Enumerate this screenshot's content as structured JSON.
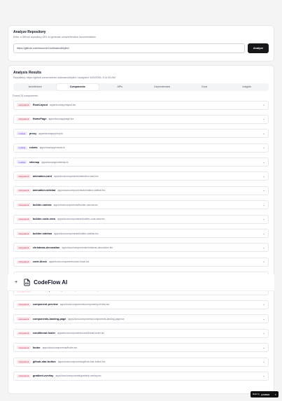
{
  "analyze": {
    "title": "Analyze Repository",
    "subtitle": "Enter a GitHub repository URL to generate comprehensive documentation",
    "repo_value": "https://github.com/moumen-soliman/uitripled",
    "button_label": "Analyze"
  },
  "results": {
    "title": "Analysis Results",
    "meta": "Repository: https://github.com/moumen-soliman/uitripled • Analyzed: 5/20/2026, 9:14:45 AM",
    "tabs": [
      "Architecture",
      "Components",
      "APIs",
      "Dependencies",
      "Docs",
      "Insights"
    ],
    "active_tab": "Components",
    "found_text": "Found 25 components"
  },
  "items": [
    {
      "type": "component",
      "name": "RootLayout",
      "path": "apps/docs/app/layout.tsx"
    },
    {
      "type": "component",
      "name": "HomePage",
      "path": "apps/docs/app/page.tsx"
    },
    {
      "type": "module",
      "name": "proxy",
      "path": "apps/docs/app/proxy.ts"
    },
    {
      "type": "module",
      "name": "robots",
      "path": "apps/docs/app/robots.ts"
    },
    {
      "type": "module",
      "name": "sitemap",
      "path": "apps/docs/app/sitemap.ts"
    },
    {
      "type": "component",
      "name": "animation-card",
      "path": "apps/docs/components/animation-card.tsx"
    },
    {
      "type": "component",
      "name": "animation-sidebar",
      "path": "apps/docs/components/animation-sidebar.tsx"
    },
    {
      "type": "component",
      "name": "builder-canvas",
      "path": "apps/docs/components/builder-canvas.tsx"
    },
    {
      "type": "component",
      "name": "builder-code-view",
      "path": "apps/docs/components/builder-code-view.tsx"
    },
    {
      "type": "component",
      "name": "builder-sidebar",
      "path": "apps/docs/components/builder-sidebar.tsx"
    },
    {
      "type": "component",
      "name": "christmas-decoration",
      "path": "apps/docs/components/christmas-decoration.tsx"
    },
    {
      "type": "component",
      "name": "code-block",
      "path": "apps/docs/components/code-block.tsx"
    },
    {
      "type": "component",
      "name": "",
      "path": ""
    },
    {
      "type": "component",
      "name": "color-theme-picker",
      "path": "apps/docs/components/color-theme-picker.tsx"
    },
    {
      "type": "component",
      "name": "component-preview",
      "path": "apps/docs/components/component-preview.tsx"
    },
    {
      "type": "component",
      "name": "components-landing-page",
      "path": "apps/docs/components/components-landing-page.tsx"
    },
    {
      "type": "component",
      "name": "conditional-footer",
      "path": "apps/docs/components/conditional-footer.tsx"
    },
    {
      "type": "component",
      "name": "footer",
      "path": "apps/docs/components/footer.tsx"
    },
    {
      "type": "component",
      "name": "github-star-button",
      "path": "apps/docs/components/github-star-button.tsx"
    },
    {
      "type": "component",
      "name": "gradient-overlay",
      "path": "apps/docs/components/gradient-overlay.tsx"
    }
  ],
  "overlay": {
    "plus": "+",
    "brand": "CodeFlow AI"
  },
  "made_with": {
    "prefix": "Made by",
    "brand": "@ARNAV",
    "close": "✕"
  },
  "icons": {
    "chevron": "chevron-down-icon",
    "logo": "file-code-icon",
    "plus": "plus-icon"
  },
  "colors": {
    "component_badge_bg": "#fde8ec",
    "component_badge_text": "#be123c",
    "module_badge_bg": "#ede9fe",
    "module_badge_text": "#6d28d9",
    "primary_button": "#18181b"
  }
}
